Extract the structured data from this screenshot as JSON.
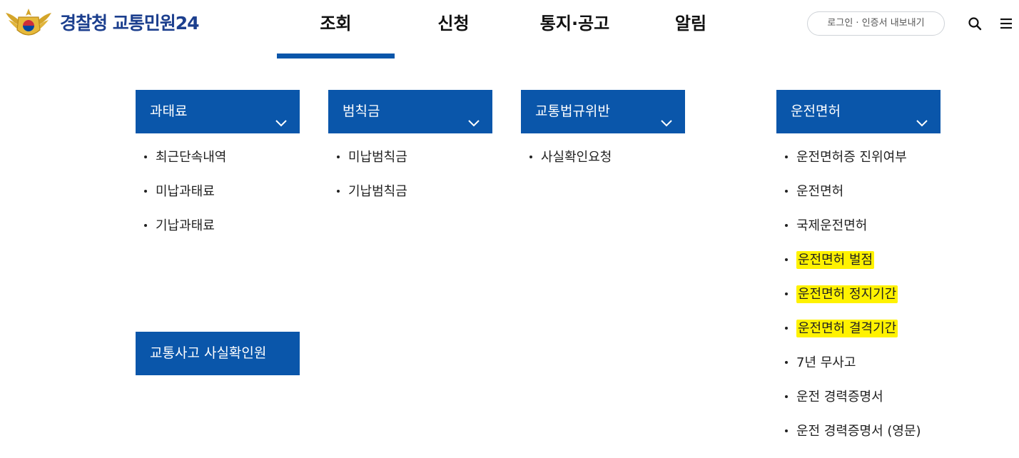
{
  "header": {
    "logo_text": "경찰청 교통민원24",
    "nav": [
      {
        "label": "조회",
        "active": true
      },
      {
        "label": "신청",
        "active": false
      },
      {
        "label": "통지·공고",
        "active": false
      },
      {
        "label": "알림",
        "active": false
      }
    ],
    "login_label": "로그인 · 인증서 내보내기",
    "search_icon": "search-icon",
    "menu_icon": "hamburger-menu-icon"
  },
  "menu": {
    "fines": {
      "title": "과태료",
      "items": [
        "최근단속내역",
        "미납과태료",
        "기납과태료"
      ]
    },
    "penalties": {
      "title": "범칙금",
      "items": [
        "미납범칙금",
        "기납범칙금"
      ]
    },
    "violations": {
      "title": "교통법규위반",
      "items": [
        "사실확인요청"
      ]
    },
    "license": {
      "title": "운전면허",
      "items": [
        "운전면허증 진위여부",
        "운전면허",
        "국제운전면허",
        "운전면허 벌점",
        "운전면허 정지기간",
        "운전면허 결격기간",
        "7년 무사고",
        "운전 경력증명서",
        "운전 경력증명서 (영문)"
      ],
      "highlighted": [
        3,
        4,
        5
      ]
    },
    "accident": {
      "title": "교통사고 사실확인원"
    }
  },
  "colors": {
    "accent": "#0a56aa",
    "logo_text": "#1c3f8e",
    "highlight": "#fff200"
  }
}
